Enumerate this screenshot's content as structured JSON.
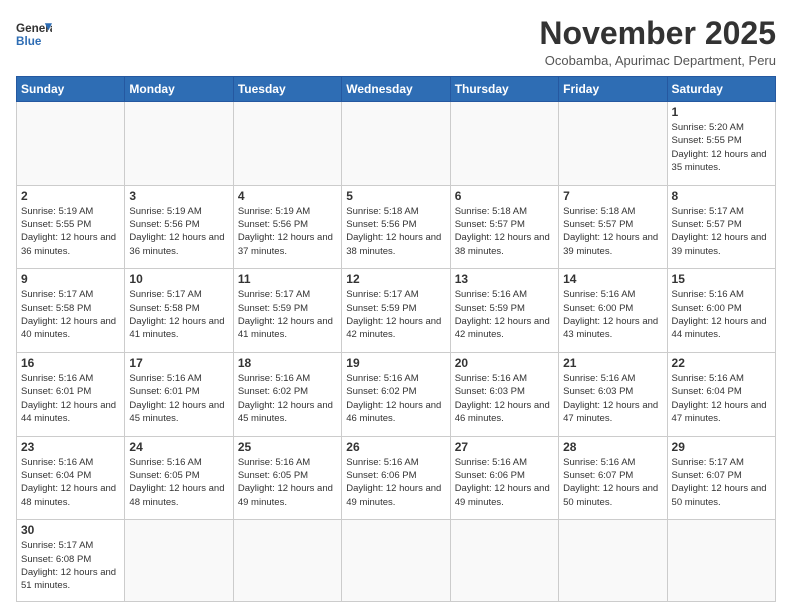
{
  "logo": {
    "line1": "General",
    "line2": "Blue"
  },
  "title": "November 2025",
  "subtitle": "Ocobamba, Apurimac Department, Peru",
  "days_of_week": [
    "Sunday",
    "Monday",
    "Tuesday",
    "Wednesday",
    "Thursday",
    "Friday",
    "Saturday"
  ],
  "weeks": [
    [
      {
        "day": "",
        "info": ""
      },
      {
        "day": "",
        "info": ""
      },
      {
        "day": "",
        "info": ""
      },
      {
        "day": "",
        "info": ""
      },
      {
        "day": "",
        "info": ""
      },
      {
        "day": "",
        "info": ""
      },
      {
        "day": "1",
        "info": "Sunrise: 5:20 AM\nSunset: 5:55 PM\nDaylight: 12 hours\nand 35 minutes."
      }
    ],
    [
      {
        "day": "2",
        "info": "Sunrise: 5:19 AM\nSunset: 5:55 PM\nDaylight: 12 hours\nand 36 minutes."
      },
      {
        "day": "3",
        "info": "Sunrise: 5:19 AM\nSunset: 5:56 PM\nDaylight: 12 hours\nand 36 minutes."
      },
      {
        "day": "4",
        "info": "Sunrise: 5:19 AM\nSunset: 5:56 PM\nDaylight: 12 hours\nand 37 minutes."
      },
      {
        "day": "5",
        "info": "Sunrise: 5:18 AM\nSunset: 5:56 PM\nDaylight: 12 hours\nand 38 minutes."
      },
      {
        "day": "6",
        "info": "Sunrise: 5:18 AM\nSunset: 5:57 PM\nDaylight: 12 hours\nand 38 minutes."
      },
      {
        "day": "7",
        "info": "Sunrise: 5:18 AM\nSunset: 5:57 PM\nDaylight: 12 hours\nand 39 minutes."
      },
      {
        "day": "8",
        "info": "Sunrise: 5:17 AM\nSunset: 5:57 PM\nDaylight: 12 hours\nand 39 minutes."
      }
    ],
    [
      {
        "day": "9",
        "info": "Sunrise: 5:17 AM\nSunset: 5:58 PM\nDaylight: 12 hours\nand 40 minutes."
      },
      {
        "day": "10",
        "info": "Sunrise: 5:17 AM\nSunset: 5:58 PM\nDaylight: 12 hours\nand 41 minutes."
      },
      {
        "day": "11",
        "info": "Sunrise: 5:17 AM\nSunset: 5:59 PM\nDaylight: 12 hours\nand 41 minutes."
      },
      {
        "day": "12",
        "info": "Sunrise: 5:17 AM\nSunset: 5:59 PM\nDaylight: 12 hours\nand 42 minutes."
      },
      {
        "day": "13",
        "info": "Sunrise: 5:16 AM\nSunset: 5:59 PM\nDaylight: 12 hours\nand 42 minutes."
      },
      {
        "day": "14",
        "info": "Sunrise: 5:16 AM\nSunset: 6:00 PM\nDaylight: 12 hours\nand 43 minutes."
      },
      {
        "day": "15",
        "info": "Sunrise: 5:16 AM\nSunset: 6:00 PM\nDaylight: 12 hours\nand 44 minutes."
      }
    ],
    [
      {
        "day": "16",
        "info": "Sunrise: 5:16 AM\nSunset: 6:01 PM\nDaylight: 12 hours\nand 44 minutes."
      },
      {
        "day": "17",
        "info": "Sunrise: 5:16 AM\nSunset: 6:01 PM\nDaylight: 12 hours\nand 45 minutes."
      },
      {
        "day": "18",
        "info": "Sunrise: 5:16 AM\nSunset: 6:02 PM\nDaylight: 12 hours\nand 45 minutes."
      },
      {
        "day": "19",
        "info": "Sunrise: 5:16 AM\nSunset: 6:02 PM\nDaylight: 12 hours\nand 46 minutes."
      },
      {
        "day": "20",
        "info": "Sunrise: 5:16 AM\nSunset: 6:03 PM\nDaylight: 12 hours\nand 46 minutes."
      },
      {
        "day": "21",
        "info": "Sunrise: 5:16 AM\nSunset: 6:03 PM\nDaylight: 12 hours\nand 47 minutes."
      },
      {
        "day": "22",
        "info": "Sunrise: 5:16 AM\nSunset: 6:04 PM\nDaylight: 12 hours\nand 47 minutes."
      }
    ],
    [
      {
        "day": "23",
        "info": "Sunrise: 5:16 AM\nSunset: 6:04 PM\nDaylight: 12 hours\nand 48 minutes."
      },
      {
        "day": "24",
        "info": "Sunrise: 5:16 AM\nSunset: 6:05 PM\nDaylight: 12 hours\nand 48 minutes."
      },
      {
        "day": "25",
        "info": "Sunrise: 5:16 AM\nSunset: 6:05 PM\nDaylight: 12 hours\nand 49 minutes."
      },
      {
        "day": "26",
        "info": "Sunrise: 5:16 AM\nSunset: 6:06 PM\nDaylight: 12 hours\nand 49 minutes."
      },
      {
        "day": "27",
        "info": "Sunrise: 5:16 AM\nSunset: 6:06 PM\nDaylight: 12 hours\nand 49 minutes."
      },
      {
        "day": "28",
        "info": "Sunrise: 5:16 AM\nSunset: 6:07 PM\nDaylight: 12 hours\nand 50 minutes."
      },
      {
        "day": "29",
        "info": "Sunrise: 5:17 AM\nSunset: 6:07 PM\nDaylight: 12 hours\nand 50 minutes."
      }
    ],
    [
      {
        "day": "30",
        "info": "Sunrise: 5:17 AM\nSunset: 6:08 PM\nDaylight: 12 hours\nand 51 minutes."
      },
      {
        "day": "",
        "info": ""
      },
      {
        "day": "",
        "info": ""
      },
      {
        "day": "",
        "info": ""
      },
      {
        "day": "",
        "info": ""
      },
      {
        "day": "",
        "info": ""
      },
      {
        "day": "",
        "info": ""
      }
    ]
  ],
  "colors": {
    "header_bg": "#2e6db4",
    "header_text": "#ffffff",
    "border": "#cccccc"
  }
}
